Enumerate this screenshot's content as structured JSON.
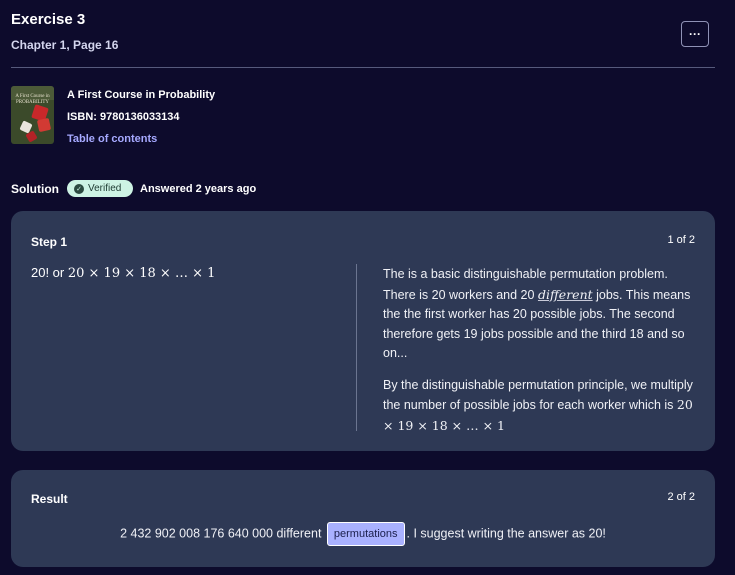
{
  "header": {
    "title": "Exercise 3",
    "subtitle": "Chapter 1, Page 16",
    "more_label": "···"
  },
  "book": {
    "cover_text": "A First Course in PROBABILITY",
    "title": "A First Course in Probability",
    "isbn": "ISBN: 9780136033134",
    "toc_link": "Table of contents",
    "icon": "book-cover-image"
  },
  "solution": {
    "label": "Solution",
    "badge": "Verified",
    "badge_icon": "check-seal-icon",
    "answered": "Answered 2 years ago"
  },
  "step": {
    "label": "Step 1",
    "counter": "1 of 2",
    "left_prefix": "20! or ",
    "left_math": "20 × 19 × 18 × … × 1",
    "para1_a": "The is a basic distinguishable permutation problem. There is 20 workers and 20 ",
    "para1_math": "different",
    "para1_b": " jobs. This means the the first worker has 20 possible jobs. The second therefore gets 19 jobs possible and the third 18 and so on...",
    "para2_a": "By the distinguishable permutation principle, we multiply the number of possible jobs for each worker which is ",
    "para2_math": "20 × 19 × 18 × … × 1"
  },
  "result": {
    "label": "Result",
    "counter": "2 of 2",
    "text_a": "2 432 902 008 176 640 000 different",
    "chip": "permutations",
    "text_b": ". I suggest writing the answer as 20!"
  },
  "colors": {
    "background": "#0d0b2c",
    "card": "#2e3955",
    "link": "#a6a9ff",
    "badge": "#cdf3e4",
    "chip": "#a9b1ff"
  }
}
